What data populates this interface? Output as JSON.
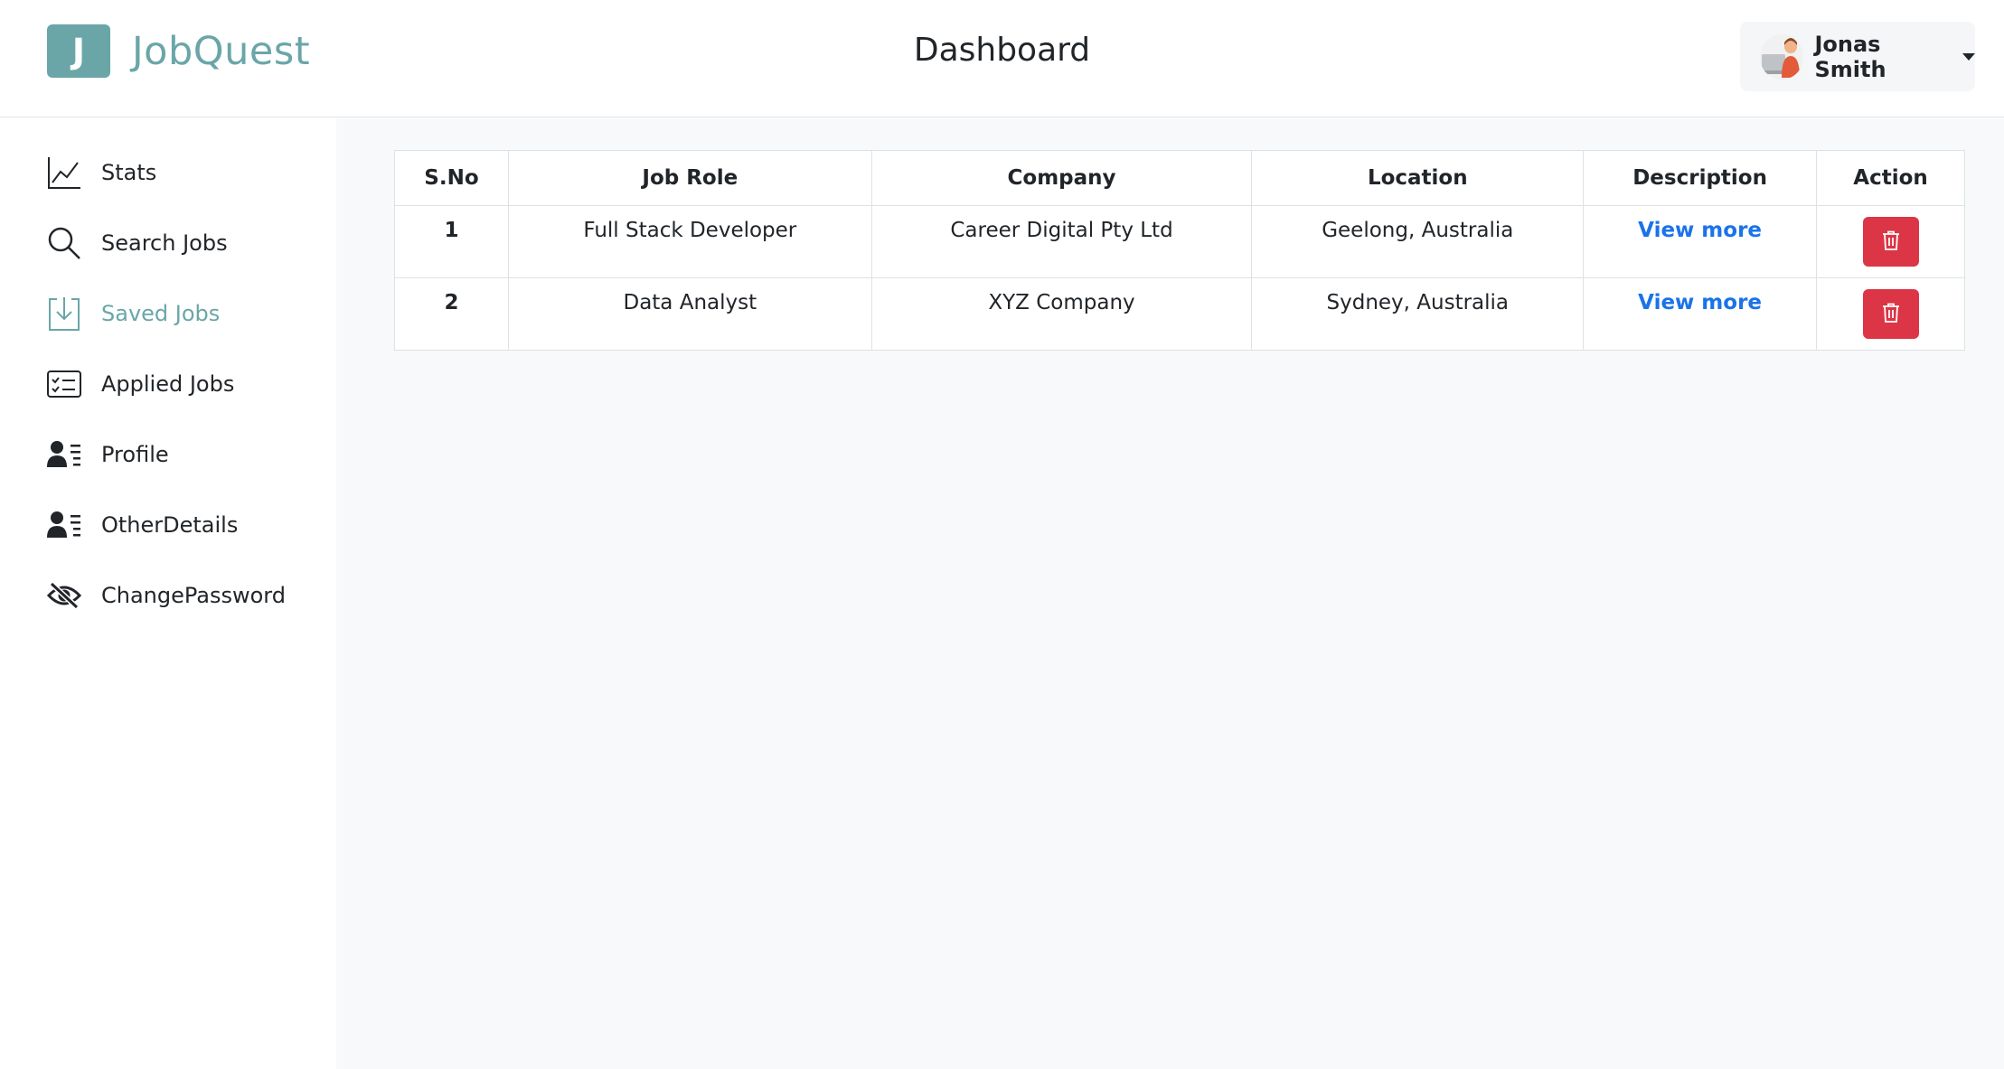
{
  "brand": {
    "initial": "J",
    "name": "JobQuest",
    "color": "#6aa6a8"
  },
  "header": {
    "title": "Dashboard"
  },
  "user": {
    "name": "Jonas Smith"
  },
  "sidebar": {
    "items": [
      {
        "label": "Stats",
        "icon": "line-chart-icon"
      },
      {
        "label": "Search Jobs",
        "icon": "search-icon"
      },
      {
        "label": "Saved Jobs",
        "icon": "download-box-icon",
        "active": true
      },
      {
        "label": "Applied Jobs",
        "icon": "checklist-icon"
      },
      {
        "label": "Profile",
        "icon": "person-lines-icon"
      },
      {
        "label": "OtherDetails",
        "icon": "person-lines-icon"
      },
      {
        "label": "ChangePassword",
        "icon": "eye-slash-icon"
      }
    ]
  },
  "table": {
    "headers": [
      "S.No",
      "Job Role",
      "Company",
      "Location",
      "Description",
      "Action"
    ],
    "rows": [
      {
        "sno": "1",
        "role": "Full Stack Developer",
        "company": "Career Digital Pty Ltd",
        "location": "Geelong, Australia",
        "description": "View more"
      },
      {
        "sno": "2",
        "role": "Data Analyst",
        "company": "XYZ Company",
        "location": "Sydney, Australia",
        "description": "View more"
      }
    ]
  },
  "colors": {
    "accent": "#6aa6a8",
    "danger": "#dc3545",
    "link": "#1a73e8"
  }
}
